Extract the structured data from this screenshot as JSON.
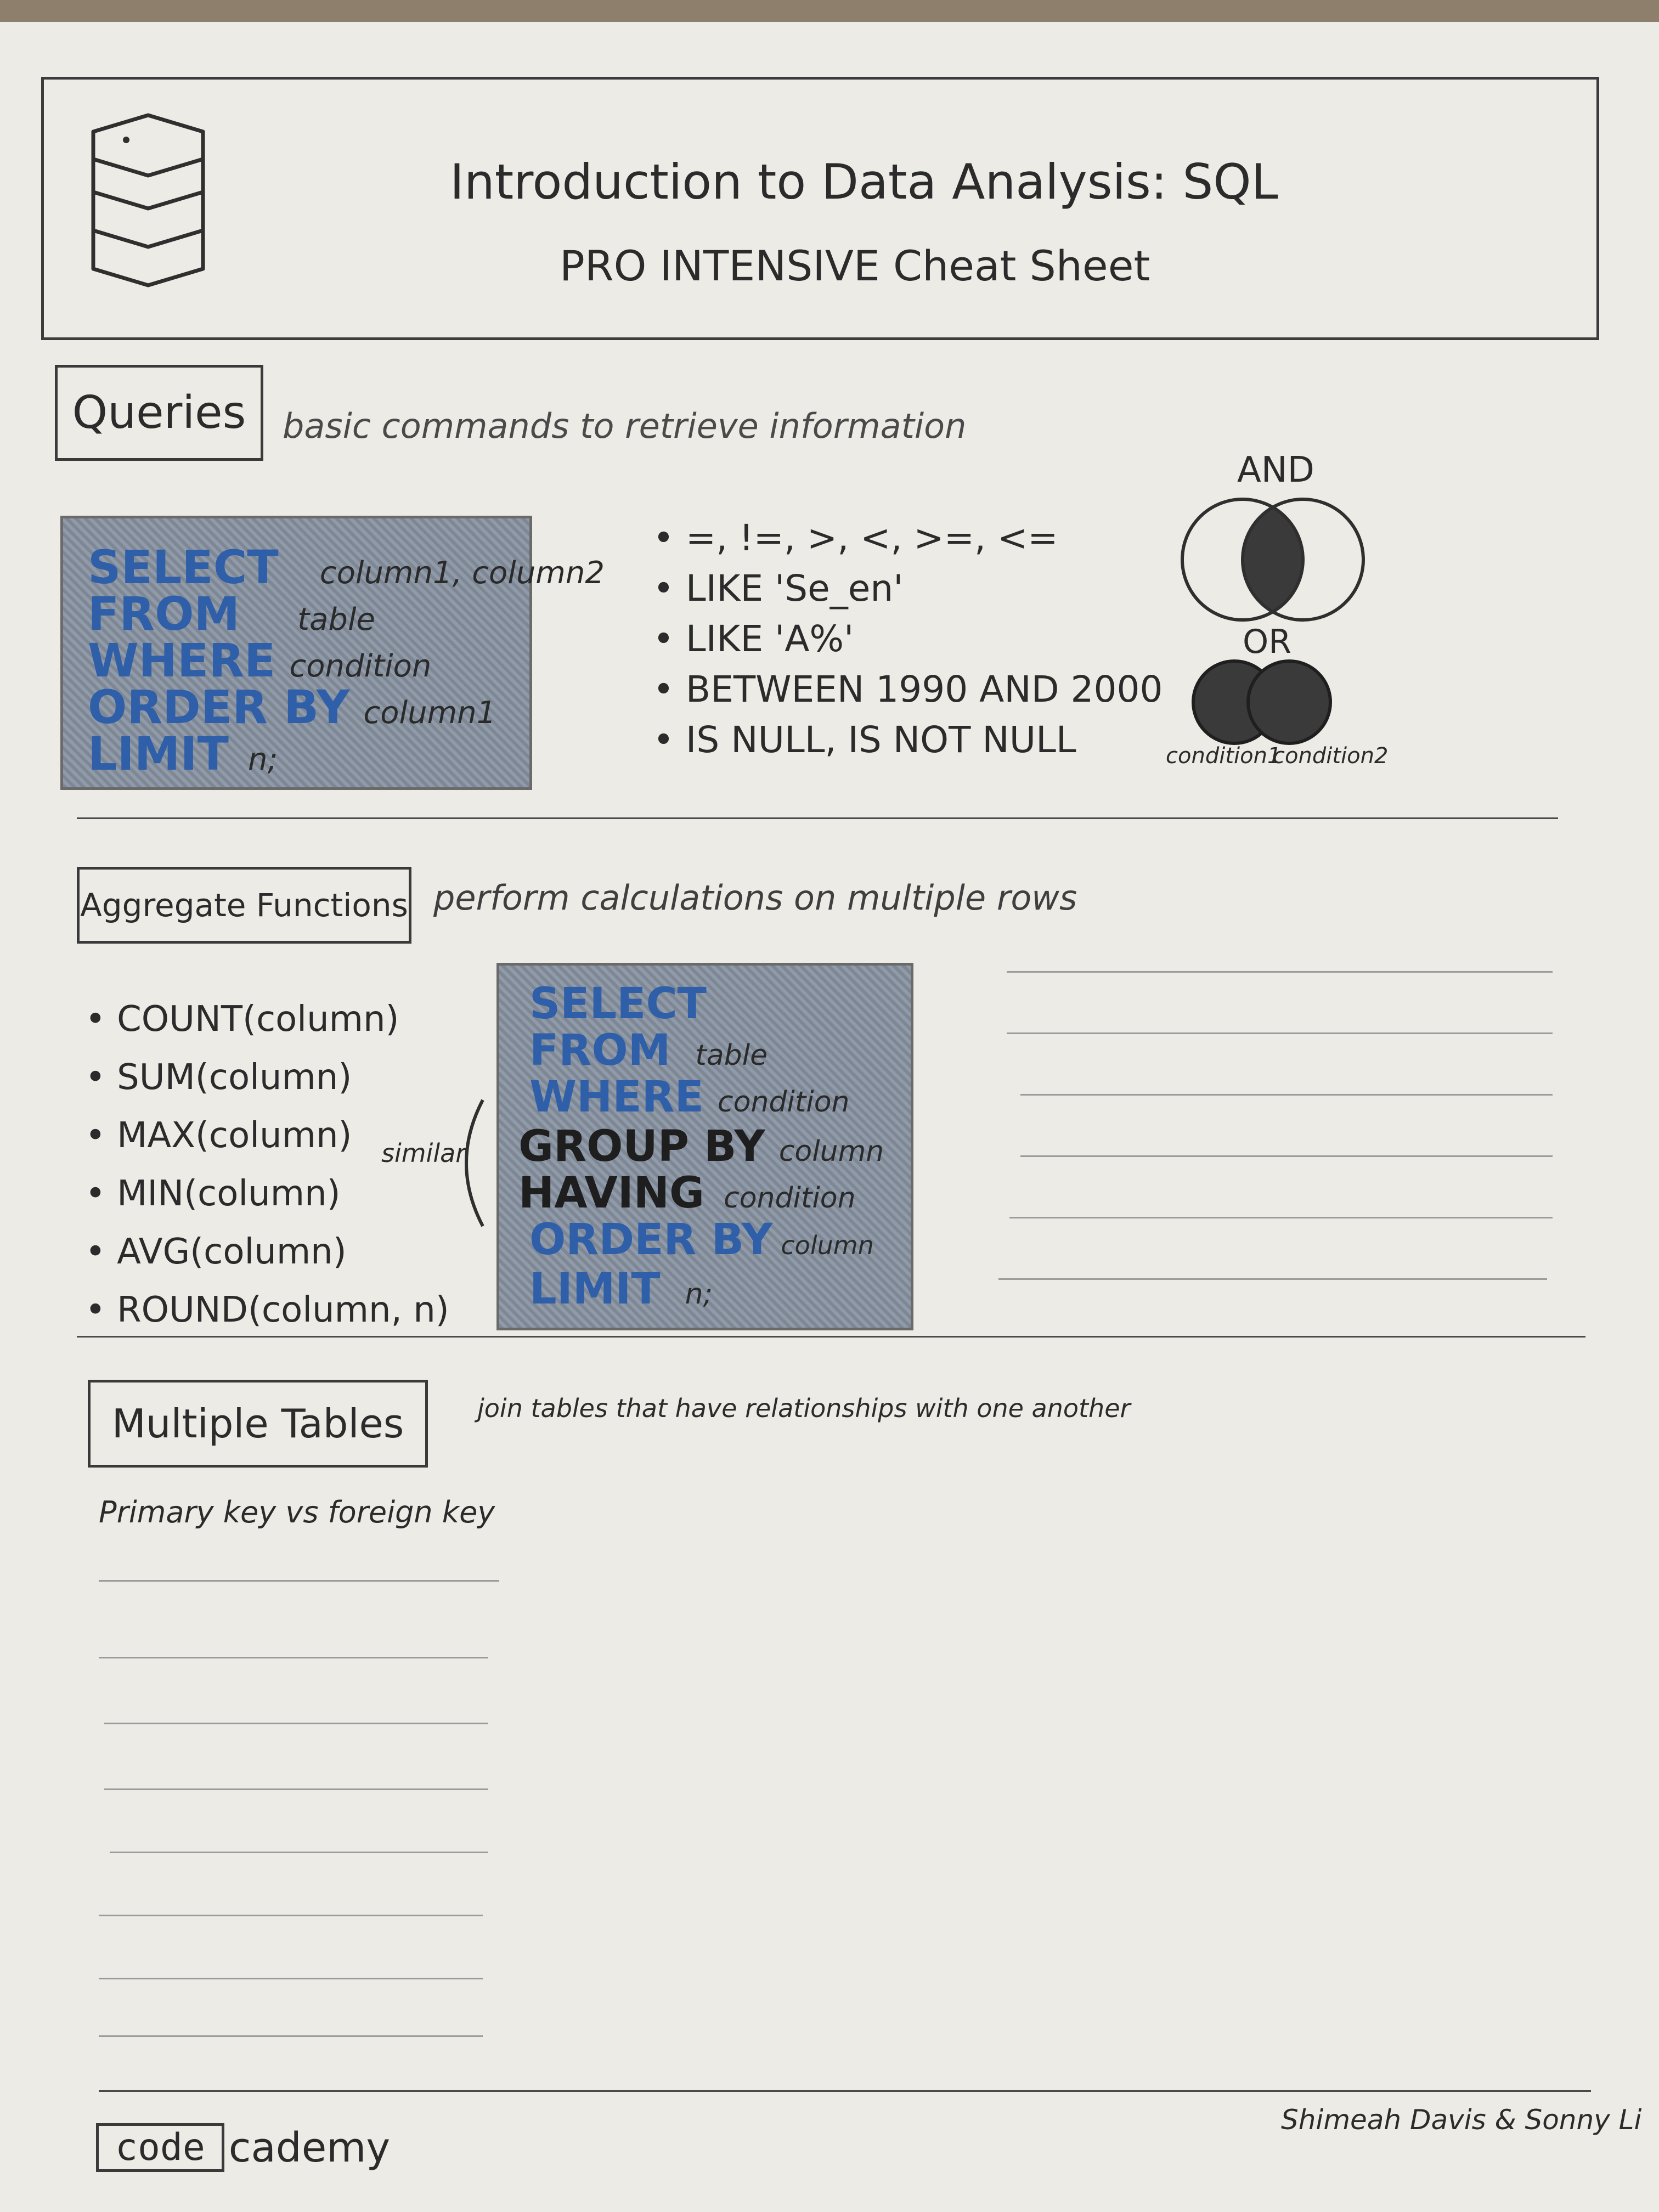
{
  "header": {
    "title": "Introduction to Data Analysis: SQL",
    "subtitle": "PRO INTENSIVE Cheat Sheet"
  },
  "queries": {
    "label": "Queries",
    "description": "basic commands to retrieve information",
    "code": [
      {
        "keyword": "SELECT",
        "arg": "column1, column2"
      },
      {
        "keyword": "FROM",
        "arg": "table"
      },
      {
        "keyword": "WHERE",
        "arg": "condition"
      },
      {
        "keyword": "ORDER BY",
        "arg": "column1"
      },
      {
        "keyword": "LIMIT",
        "arg": "n;"
      }
    ],
    "operators": [
      "=, !=, >, <, >=, <=",
      "LIKE 'Se_en'",
      "LIKE 'A%'",
      "BETWEEN 1990 AND 2000",
      "IS NULL, IS NOT NULL"
    ],
    "venn": {
      "and_label": "AND",
      "or_label": "OR",
      "condition1": "condition1",
      "condition2": "condition2"
    }
  },
  "aggregate": {
    "label": "Aggregate Functions",
    "description": "perform calculations on multiple rows",
    "functions": [
      "COUNT(column)",
      "SUM(column)",
      "MAX(column)",
      "MIN(column)",
      "AVG(column)",
      "ROUND(column, n)"
    ],
    "similar_label": "similar",
    "code": [
      {
        "keyword": "SELECT",
        "arg": ""
      },
      {
        "keyword": "FROM",
        "arg": "table"
      },
      {
        "keyword": "WHERE",
        "arg": "condition"
      },
      {
        "keyword": "GROUP BY",
        "arg": "column"
      },
      {
        "keyword": "HAVING",
        "arg": "condition"
      },
      {
        "keyword": "ORDER BY",
        "arg": "column"
      },
      {
        "keyword": "LIMIT",
        "arg": "n;"
      }
    ]
  },
  "multiple_tables": {
    "label": "Multiple Tables",
    "description": "join tables that have relationships with one another",
    "note": "Primary key vs foreign key"
  },
  "footer": {
    "logo_box": "code",
    "logo_rest": "cademy",
    "authors": "Shimeah Davis & Sonny Li"
  }
}
